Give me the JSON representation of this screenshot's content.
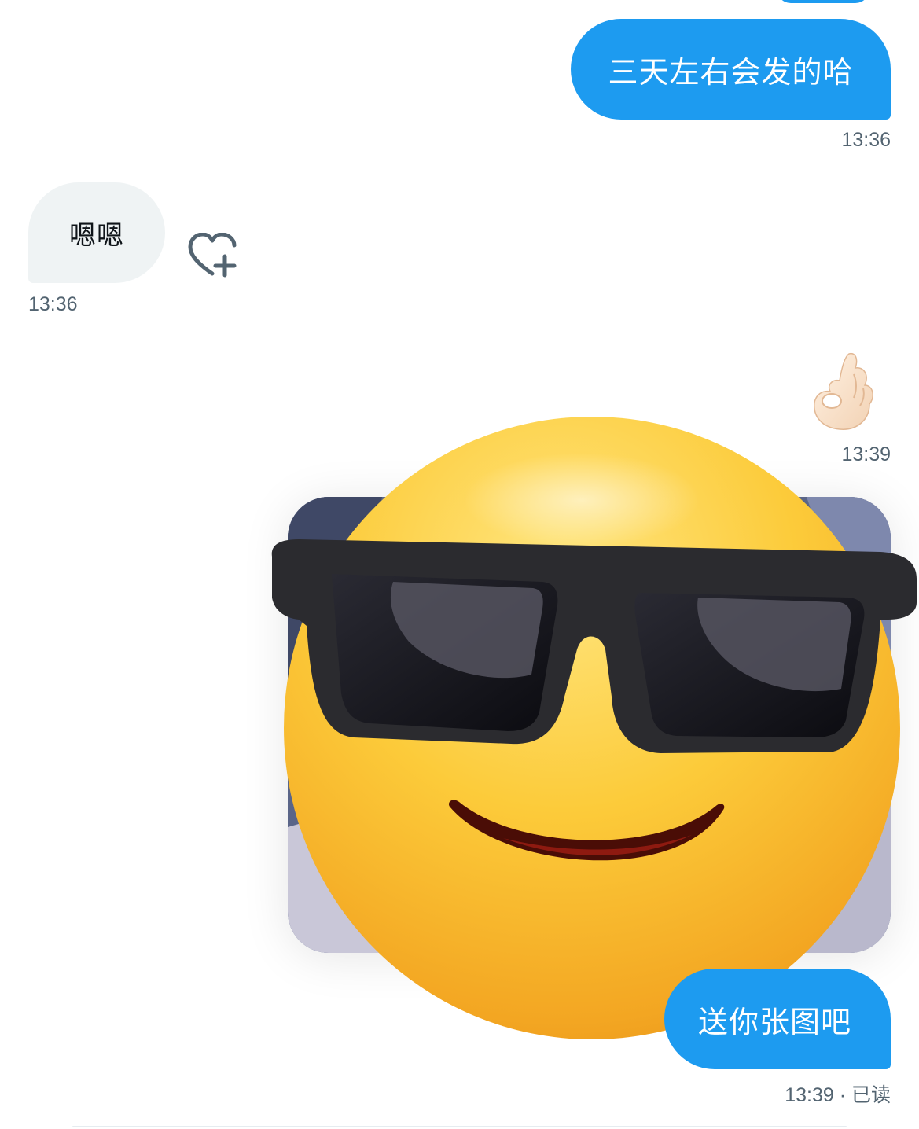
{
  "messages": [
    {
      "direction": "out",
      "text": "三天左右会发的哈",
      "time": "13:36"
    },
    {
      "direction": "in",
      "text": "嗯嗯",
      "time": "13:36"
    },
    {
      "direction": "out",
      "emoji": "ok-hand",
      "time": "13:39"
    },
    {
      "direction": "out",
      "image": "sunglasses-smiley-photo"
    },
    {
      "direction": "out",
      "text": "送你张图吧",
      "time": "13:39",
      "status": "已读",
      "separator": "·"
    }
  ],
  "icons": {
    "like": "heart-plus-icon",
    "ok_hand": "ok-hand-emoji",
    "sticker": "sunglasses-face-emoji"
  },
  "colors": {
    "outgoing_bubble": "#1d9bf0",
    "incoming_bubble": "#eff3f4",
    "timestamp": "#536471"
  }
}
